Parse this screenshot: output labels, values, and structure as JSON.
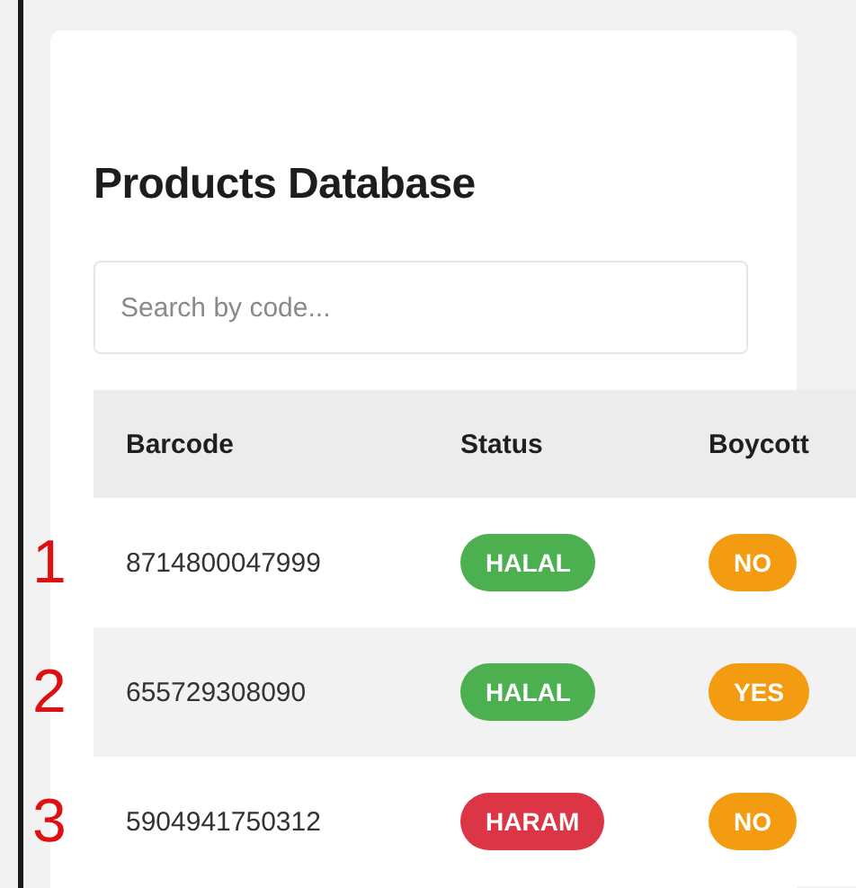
{
  "title": "Products Database",
  "search": {
    "placeholder": "Search by code..."
  },
  "table": {
    "columns": [
      "Barcode",
      "Status",
      "Boycott"
    ],
    "rows": [
      {
        "marker": "1",
        "barcode": "8714800047999",
        "status": {
          "label": "HALAL",
          "color": "#4caf50"
        },
        "boycott": {
          "label": "NO",
          "color": "#f39c12"
        }
      },
      {
        "marker": "2",
        "barcode": "655729308090",
        "status": {
          "label": "HALAL",
          "color": "#4caf50"
        },
        "boycott": {
          "label": "YES",
          "color": "#f39c12"
        }
      },
      {
        "marker": "3",
        "barcode": "5904941750312",
        "status": {
          "label": "HARAM",
          "color": "#dc3545"
        },
        "boycott": {
          "label": "NO",
          "color": "#f39c12"
        }
      }
    ]
  }
}
